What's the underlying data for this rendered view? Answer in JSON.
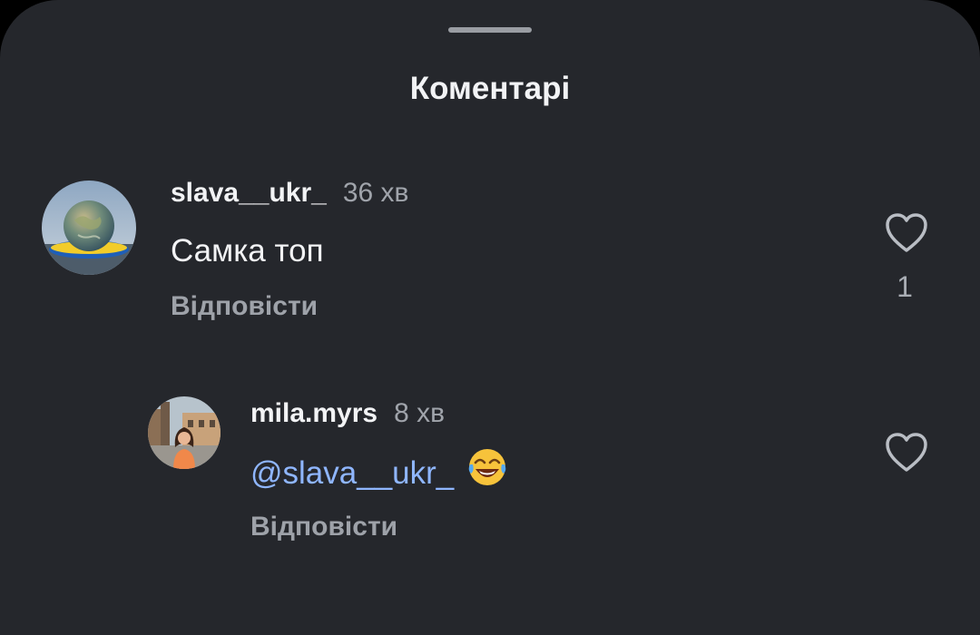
{
  "sheet": {
    "title": "Коментарі"
  },
  "comments": [
    {
      "username": "slava__ukr_",
      "time": "36 хв",
      "text": "Самка топ",
      "reply_label": "Відповісти",
      "like_count": "1",
      "like_icon": "heart-outline-icon"
    },
    {
      "username": "mila.myrs",
      "time": "8 хв",
      "mention": "@slava__ukr_",
      "emoji": "face-with-tears-of-joy",
      "reply_label": "Відповісти",
      "like_icon": "heart-outline-icon"
    }
  ],
  "colors": {
    "background": "#25272c",
    "mention": "#8fb6ff",
    "secondary_text": "#9ea2a9"
  }
}
